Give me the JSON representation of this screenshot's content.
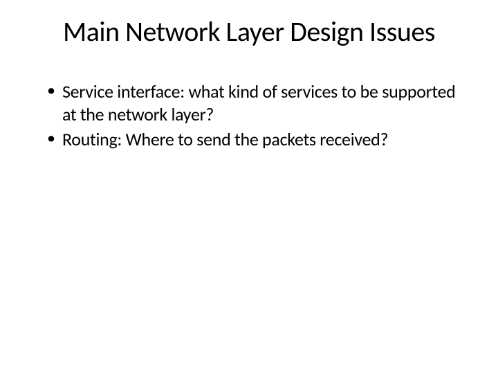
{
  "slide": {
    "title": "Main Network Layer Design Issues",
    "bullets": [
      "Service interface: what kind of services to be supported at the network layer?",
      "Routing: Where to send the packets received?"
    ]
  }
}
